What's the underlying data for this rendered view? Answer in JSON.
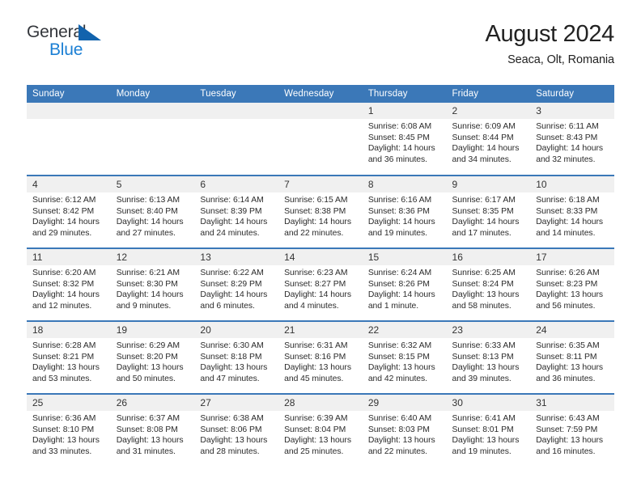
{
  "brand": {
    "line1": "General",
    "line2": "Blue",
    "accent_dark": "#33363b",
    "accent_blue": "#1b7fd4",
    "triangle_blue": "#1263ad"
  },
  "header": {
    "title": "August 2024",
    "subtitle": "Seaca, Olt, Romania",
    "header_bg": "#3b78b8",
    "daynum_bg": "#f0f0f0"
  },
  "weekday_headers": [
    "Sunday",
    "Monday",
    "Tuesday",
    "Wednesday",
    "Thursday",
    "Friday",
    "Saturday"
  ],
  "labels": {
    "sunrise_prefix": "Sunrise:",
    "sunset_prefix": "Sunset:",
    "daylight_prefix": "Daylight:"
  },
  "weeks": [
    [
      {
        "day": "",
        "blank": true,
        "l1": "",
        "l2": "",
        "l3": "",
        "l4": ""
      },
      {
        "day": "",
        "blank": true,
        "l1": "",
        "l2": "",
        "l3": "",
        "l4": ""
      },
      {
        "day": "",
        "blank": true,
        "l1": "",
        "l2": "",
        "l3": "",
        "l4": ""
      },
      {
        "day": "",
        "blank": true,
        "l1": "",
        "l2": "",
        "l3": "",
        "l4": ""
      },
      {
        "day": "1",
        "blank": false,
        "l1": "Sunrise: 6:08 AM",
        "l2": "Sunset: 8:45 PM",
        "l3": "Daylight: 14 hours",
        "l4": "and 36 minutes."
      },
      {
        "day": "2",
        "blank": false,
        "l1": "Sunrise: 6:09 AM",
        "l2": "Sunset: 8:44 PM",
        "l3": "Daylight: 14 hours",
        "l4": "and 34 minutes."
      },
      {
        "day": "3",
        "blank": false,
        "l1": "Sunrise: 6:11 AM",
        "l2": "Sunset: 8:43 PM",
        "l3": "Daylight: 14 hours",
        "l4": "and 32 minutes."
      }
    ],
    [
      {
        "day": "4",
        "blank": false,
        "l1": "Sunrise: 6:12 AM",
        "l2": "Sunset: 8:42 PM",
        "l3": "Daylight: 14 hours",
        "l4": "and 29 minutes."
      },
      {
        "day": "5",
        "blank": false,
        "l1": "Sunrise: 6:13 AM",
        "l2": "Sunset: 8:40 PM",
        "l3": "Daylight: 14 hours",
        "l4": "and 27 minutes."
      },
      {
        "day": "6",
        "blank": false,
        "l1": "Sunrise: 6:14 AM",
        "l2": "Sunset: 8:39 PM",
        "l3": "Daylight: 14 hours",
        "l4": "and 24 minutes."
      },
      {
        "day": "7",
        "blank": false,
        "l1": "Sunrise: 6:15 AM",
        "l2": "Sunset: 8:38 PM",
        "l3": "Daylight: 14 hours",
        "l4": "and 22 minutes."
      },
      {
        "day": "8",
        "blank": false,
        "l1": "Sunrise: 6:16 AM",
        "l2": "Sunset: 8:36 PM",
        "l3": "Daylight: 14 hours",
        "l4": "and 19 minutes."
      },
      {
        "day": "9",
        "blank": false,
        "l1": "Sunrise: 6:17 AM",
        "l2": "Sunset: 8:35 PM",
        "l3": "Daylight: 14 hours",
        "l4": "and 17 minutes."
      },
      {
        "day": "10",
        "blank": false,
        "l1": "Sunrise: 6:18 AM",
        "l2": "Sunset: 8:33 PM",
        "l3": "Daylight: 14 hours",
        "l4": "and 14 minutes."
      }
    ],
    [
      {
        "day": "11",
        "blank": false,
        "l1": "Sunrise: 6:20 AM",
        "l2": "Sunset: 8:32 PM",
        "l3": "Daylight: 14 hours",
        "l4": "and 12 minutes."
      },
      {
        "day": "12",
        "blank": false,
        "l1": "Sunrise: 6:21 AM",
        "l2": "Sunset: 8:30 PM",
        "l3": "Daylight: 14 hours",
        "l4": "and 9 minutes."
      },
      {
        "day": "13",
        "blank": false,
        "l1": "Sunrise: 6:22 AM",
        "l2": "Sunset: 8:29 PM",
        "l3": "Daylight: 14 hours",
        "l4": "and 6 minutes."
      },
      {
        "day": "14",
        "blank": false,
        "l1": "Sunrise: 6:23 AM",
        "l2": "Sunset: 8:27 PM",
        "l3": "Daylight: 14 hours",
        "l4": "and 4 minutes."
      },
      {
        "day": "15",
        "blank": false,
        "l1": "Sunrise: 6:24 AM",
        "l2": "Sunset: 8:26 PM",
        "l3": "Daylight: 14 hours",
        "l4": "and 1 minute."
      },
      {
        "day": "16",
        "blank": false,
        "l1": "Sunrise: 6:25 AM",
        "l2": "Sunset: 8:24 PM",
        "l3": "Daylight: 13 hours",
        "l4": "and 58 minutes."
      },
      {
        "day": "17",
        "blank": false,
        "l1": "Sunrise: 6:26 AM",
        "l2": "Sunset: 8:23 PM",
        "l3": "Daylight: 13 hours",
        "l4": "and 56 minutes."
      }
    ],
    [
      {
        "day": "18",
        "blank": false,
        "l1": "Sunrise: 6:28 AM",
        "l2": "Sunset: 8:21 PM",
        "l3": "Daylight: 13 hours",
        "l4": "and 53 minutes."
      },
      {
        "day": "19",
        "blank": false,
        "l1": "Sunrise: 6:29 AM",
        "l2": "Sunset: 8:20 PM",
        "l3": "Daylight: 13 hours",
        "l4": "and 50 minutes."
      },
      {
        "day": "20",
        "blank": false,
        "l1": "Sunrise: 6:30 AM",
        "l2": "Sunset: 8:18 PM",
        "l3": "Daylight: 13 hours",
        "l4": "and 47 minutes."
      },
      {
        "day": "21",
        "blank": false,
        "l1": "Sunrise: 6:31 AM",
        "l2": "Sunset: 8:16 PM",
        "l3": "Daylight: 13 hours",
        "l4": "and 45 minutes."
      },
      {
        "day": "22",
        "blank": false,
        "l1": "Sunrise: 6:32 AM",
        "l2": "Sunset: 8:15 PM",
        "l3": "Daylight: 13 hours",
        "l4": "and 42 minutes."
      },
      {
        "day": "23",
        "blank": false,
        "l1": "Sunrise: 6:33 AM",
        "l2": "Sunset: 8:13 PM",
        "l3": "Daylight: 13 hours",
        "l4": "and 39 minutes."
      },
      {
        "day": "24",
        "blank": false,
        "l1": "Sunrise: 6:35 AM",
        "l2": "Sunset: 8:11 PM",
        "l3": "Daylight: 13 hours",
        "l4": "and 36 minutes."
      }
    ],
    [
      {
        "day": "25",
        "blank": false,
        "l1": "Sunrise: 6:36 AM",
        "l2": "Sunset: 8:10 PM",
        "l3": "Daylight: 13 hours",
        "l4": "and 33 minutes."
      },
      {
        "day": "26",
        "blank": false,
        "l1": "Sunrise: 6:37 AM",
        "l2": "Sunset: 8:08 PM",
        "l3": "Daylight: 13 hours",
        "l4": "and 31 minutes."
      },
      {
        "day": "27",
        "blank": false,
        "l1": "Sunrise: 6:38 AM",
        "l2": "Sunset: 8:06 PM",
        "l3": "Daylight: 13 hours",
        "l4": "and 28 minutes."
      },
      {
        "day": "28",
        "blank": false,
        "l1": "Sunrise: 6:39 AM",
        "l2": "Sunset: 8:04 PM",
        "l3": "Daylight: 13 hours",
        "l4": "and 25 minutes."
      },
      {
        "day": "29",
        "blank": false,
        "l1": "Sunrise: 6:40 AM",
        "l2": "Sunset: 8:03 PM",
        "l3": "Daylight: 13 hours",
        "l4": "and 22 minutes."
      },
      {
        "day": "30",
        "blank": false,
        "l1": "Sunrise: 6:41 AM",
        "l2": "Sunset: 8:01 PM",
        "l3": "Daylight: 13 hours",
        "l4": "and 19 minutes."
      },
      {
        "day": "31",
        "blank": false,
        "l1": "Sunrise: 6:43 AM",
        "l2": "Sunset: 7:59 PM",
        "l3": "Daylight: 13 hours",
        "l4": "and 16 minutes."
      }
    ]
  ]
}
